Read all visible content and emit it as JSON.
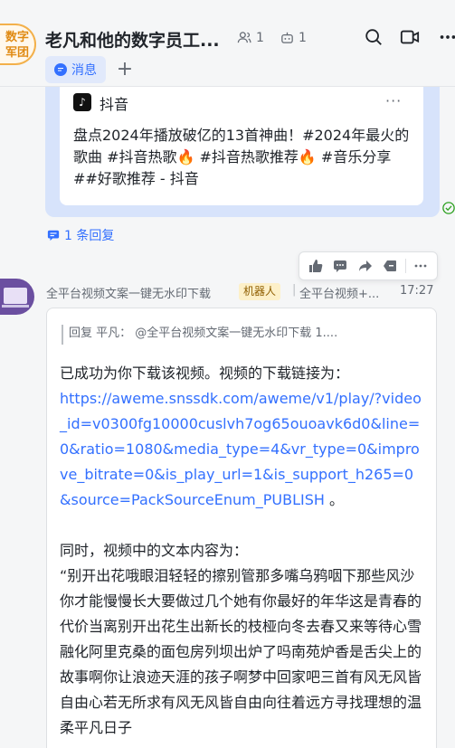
{
  "header": {
    "group_avatar_text": "数字军团",
    "title": "老凡和他的数字员工...",
    "member_count": "1",
    "bot_count": "1",
    "tab_label": "消息",
    "plus": "+"
  },
  "shared_card": {
    "source_name": "抖音",
    "more": "···",
    "text": "盘点2024年播放破亿的13首神曲！#2024年最火的歌曲 #抖音热歌🔥 #抖音热歌推荐🔥 #音乐分享 ##好歌推荐 - 抖音"
  },
  "reply_count_label": "1 条回复",
  "message": {
    "sender": "全平台视频文案一键无水印下载",
    "tag": "机器人",
    "separator": "|",
    "sender_secondary": "全平台视频+...",
    "time": "17:27",
    "quote": "回复 平凡：  @全平台视频文案一键无水印下载 1....",
    "intro": "已成功为你下载该视频。视频的下载链接为：",
    "link": "https://aweme.snssdk.com/aweme/v1/play/?video_id=v0300fg10000cuslvh7og65ouoavk6d0&line=0&ratio=1080&media_type=4&vr_type=0&improve_bitrate=0&is_play_url=1&is_support_h265=0&source=PackSourceEnum_PUBLISH",
    "link_suffix": " 。",
    "para2_head": "同时，视频中的文本内容为：",
    "para2_body": "“别开出花哦眼泪轻轻的擦别管那多嘴乌鸦咽下那些风沙你才能慢慢长大要做过几个她有你最好的年华这是青春的代价当离别开出花生出新长的枝桠向冬去春又来等待心雪融化阿里克桑的面包房列坝出炉了吗南苑炉香是舌尖上的故事啊你让浪迹天涯的孩子啊梦中回家吧三首有风无风皆自由心若无所求有风无风皆自由向往着远方寻找理想的温柔平凡日子"
  },
  "icons": {
    "search": "search-icon",
    "video": "video-call-icon",
    "more": "more-icon"
  },
  "colors": {
    "accent": "#3370ff",
    "bubble": "#d7e3fb",
    "tag_bg": "#fdf0c8"
  }
}
